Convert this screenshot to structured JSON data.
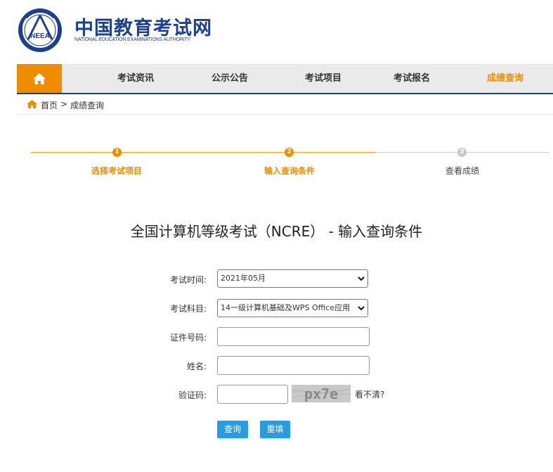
{
  "brand": {
    "logo_text": "NEEA",
    "title": "中国教育考试网",
    "subtitle": "NATIONAL EDUCATION EXAMINATIONS AUTHORITY"
  },
  "nav": {
    "items": [
      {
        "label": "考试资讯"
      },
      {
        "label": "公示公告"
      },
      {
        "label": "考试项目"
      },
      {
        "label": "考试报名"
      },
      {
        "label": "成绩查询",
        "active": true
      }
    ],
    "accent_color": "#f08c00",
    "border_color": "#1d3f8a"
  },
  "breadcrumb": {
    "home": "首页",
    "separator": ">",
    "current": "成绩查询"
  },
  "steps": [
    {
      "num": "1",
      "label": "选择考试项目",
      "status": "done"
    },
    {
      "num": "2",
      "label": "输入查询条件",
      "status": "current"
    },
    {
      "num": "3",
      "label": "查看成绩",
      "status": "todo"
    }
  ],
  "page_title": "全国计算机等级考试（NCRE） - 输入查询条件",
  "form": {
    "exam_time": {
      "label": "考试时间:",
      "value": "2021年05月"
    },
    "subject": {
      "label": "考试科目:",
      "value": "14一级计算机基础及WPS Office应用"
    },
    "id_number": {
      "label": "证件号码:",
      "value": ""
    },
    "name": {
      "label": "姓名:",
      "value": ""
    },
    "captcha": {
      "label": "验证码:",
      "value": "",
      "image_text": "px7e",
      "refresh_text": "看不清?"
    }
  },
  "buttons": {
    "query": "查询",
    "reset": "重填"
  },
  "colors": {
    "primary_button": "#2b9be0",
    "brand_blue": "#1c3f8f"
  }
}
